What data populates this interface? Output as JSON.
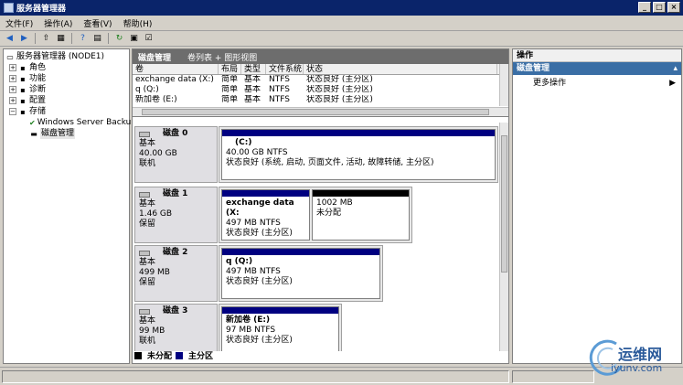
{
  "window": {
    "title": "服务器管理器"
  },
  "menu": [
    "文件(F)",
    "操作(A)",
    "查看(V)",
    "帮助(H)"
  ],
  "tree": {
    "root": "服务器管理器 (NODE1)",
    "items": [
      {
        "label": "角色"
      },
      {
        "label": "功能"
      },
      {
        "label": "诊断"
      },
      {
        "label": "配置"
      },
      {
        "label": "存储"
      }
    ],
    "storage_children": [
      "Windows Server Backup",
      "磁盘管理"
    ]
  },
  "center": {
    "title": "磁盘管理",
    "subtitle": "卷列表 + 图形视图"
  },
  "volume_table": {
    "headers": [
      "卷",
      "布局",
      "类型",
      "文件系统",
      "状态"
    ],
    "rows": [
      [
        "exchange data (X:)",
        "简单",
        "基本",
        "NTFS",
        "状态良好 (主分区)"
      ],
      [
        "q (Q:)",
        "简单",
        "基本",
        "NTFS",
        "状态良好 (主分区)"
      ],
      [
        "新加卷 (E:)",
        "简单",
        "基本",
        "NTFS",
        "状态良好 (主分区)"
      ]
    ]
  },
  "disks": [
    {
      "name": "磁盘 0",
      "type": "基本",
      "size": "40.00 GB",
      "state": "联机",
      "partitions": [
        {
          "name": "(C:)",
          "size": "40.00 GB NTFS",
          "status": "状态良好 (系统, 启动, 页面文件, 活动, 故障转储, 主分区)"
        }
      ]
    },
    {
      "name": "磁盘 1",
      "type": "基本",
      "size": "1.46 GB",
      "state": "保留",
      "partitions": [
        {
          "name": "exchange data (X:",
          "size": "497 MB NTFS",
          "status": "状态良好 (主分区)"
        },
        {
          "name": "",
          "size": "1002 MB",
          "status": "未分配"
        }
      ]
    },
    {
      "name": "磁盘 2",
      "type": "基本",
      "size": "499 MB",
      "state": "保留",
      "partitions": [
        {
          "name": "q (Q:)",
          "size": "497 MB NTFS",
          "status": "状态良好 (主分区)"
        }
      ]
    },
    {
      "name": "磁盘 3",
      "type": "基本",
      "size": "99 MB",
      "state": "联机",
      "partitions": [
        {
          "name": "新加卷 (E:)",
          "size": "97 MB NTFS",
          "status": "状态良好 (主分区)"
        }
      ]
    }
  ],
  "legend": {
    "unallocated": "未分配",
    "primary": "主分区"
  },
  "actions": {
    "header": "操作",
    "section": "磁盘管理",
    "more": "更多操作"
  },
  "watermark": {
    "line1": "运维网",
    "line2": "iyunv.com"
  },
  "colors": {
    "primary_partition": "#000080",
    "unallocated": "#000000",
    "selection": "#3a6ea5",
    "title_bar": "#0a246a"
  }
}
